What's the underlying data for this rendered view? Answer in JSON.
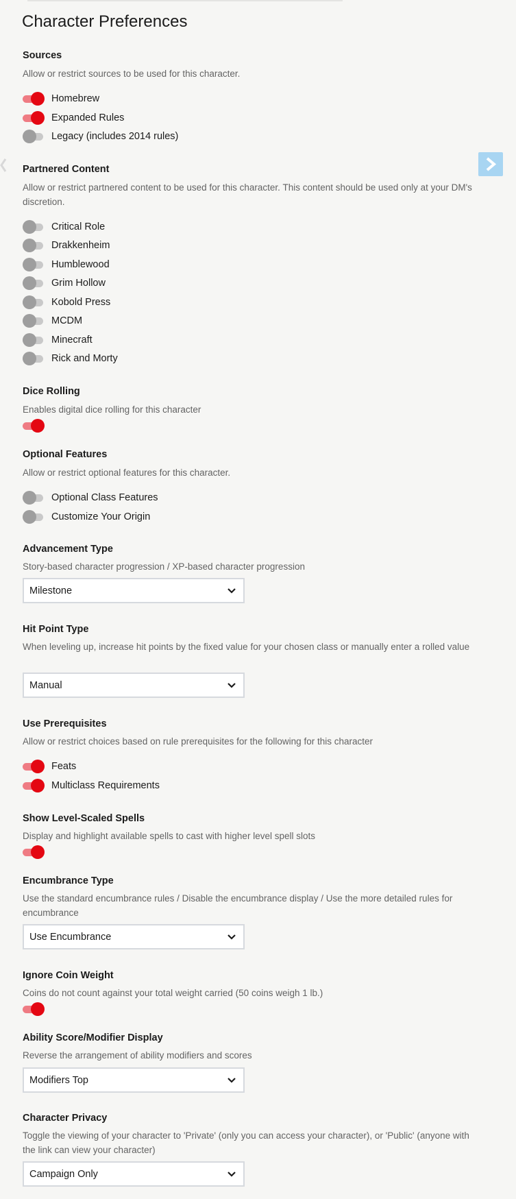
{
  "page": {
    "title": "Character Preferences"
  },
  "sources": {
    "heading": "Sources",
    "description": "Allow or restrict sources to be used for this character.",
    "options": [
      {
        "label": "Homebrew",
        "enabled": true
      },
      {
        "label": "Expanded Rules",
        "enabled": true
      },
      {
        "label": "Legacy (includes 2014 rules)",
        "enabled": false
      }
    ]
  },
  "partnered": {
    "heading": "Partnered Content",
    "description": "Allow or restrict partnered content to be used for this character. This content should be used only at your DM's discretion.",
    "options": [
      {
        "label": "Critical Role",
        "enabled": false
      },
      {
        "label": "Drakkenheim",
        "enabled": false
      },
      {
        "label": "Humblewood",
        "enabled": false
      },
      {
        "label": "Grim Hollow",
        "enabled": false
      },
      {
        "label": "Kobold Press",
        "enabled": false
      },
      {
        "label": "MCDM",
        "enabled": false
      },
      {
        "label": "Minecraft",
        "enabled": false
      },
      {
        "label": "Rick and Morty",
        "enabled": false
      }
    ]
  },
  "dice": {
    "heading": "Dice Rolling",
    "description": "Enables digital dice rolling for this character",
    "enabled": true
  },
  "optional": {
    "heading": "Optional Features",
    "description": "Allow or restrict optional features for this character.",
    "options": [
      {
        "label": "Optional Class Features",
        "enabled": false
      },
      {
        "label": "Customize Your Origin",
        "enabled": false
      }
    ]
  },
  "advancement": {
    "heading": "Advancement Type",
    "description": "Story-based character progression / XP-based character progression",
    "value": "Milestone"
  },
  "hitpoints": {
    "heading": "Hit Point Type",
    "description": "When leveling up, increase hit points by the fixed value for your chosen class or manually enter a rolled value",
    "value": "Manual"
  },
  "prereq": {
    "heading": "Use Prerequisites",
    "description": "Allow or restrict choices based on rule prerequisites for the following for this character",
    "options": [
      {
        "label": "Feats",
        "enabled": true
      },
      {
        "label": "Multiclass Requirements",
        "enabled": true
      }
    ]
  },
  "scaled": {
    "heading": "Show Level-Scaled Spells",
    "description": "Display and highlight available spells to cast with higher level spell slots",
    "enabled": true
  },
  "encumbrance": {
    "heading": "Encumbrance Type",
    "description": "Use the standard encumbrance rules / Disable the encumbrance display / Use the more detailed rules for encumbrance",
    "value": "Use Encumbrance"
  },
  "coin": {
    "heading": "Ignore Coin Weight",
    "description": "Coins do not count against your total weight carried (50 coins weigh 1 lb.)",
    "enabled": true
  },
  "ability": {
    "heading": "Ability Score/Modifier Display",
    "description": "Reverse the arrangement of ability modifiers and scores",
    "value": "Modifiers Top"
  },
  "privacy": {
    "heading": "Character Privacy",
    "description": "Toggle the viewing of your character to 'Private' (only you can access your character), or 'Public' (anyone with the link can view your character)",
    "value": "Campaign Only"
  },
  "icons": {
    "toggle": "toggle-switch-icon",
    "dropdown": "chevron-down-icon",
    "nav_next": "chevron-right-icon",
    "nav_prev": "chevron-left-icon"
  },
  "colors": {
    "accent": "#e40712",
    "accent_track": "#ef7b83",
    "off_knob": "#9e9e9e",
    "off_track": "#c9c9c9",
    "nav_button": "#a8d5f2"
  }
}
